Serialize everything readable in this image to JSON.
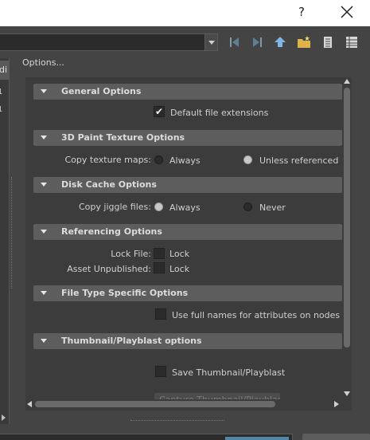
{
  "titlebar": {
    "help_label": "?",
    "close_icon": "close-icon"
  },
  "toolbar": {
    "path_value": "",
    "buttons": [
      "back-icon",
      "forward-icon",
      "parent-folder-icon",
      "new-folder-icon",
      "list-view-icon",
      "detail-view-icon"
    ]
  },
  "sidebar": {
    "tab_label": "di",
    "rows": [
      "1",
      "1"
    ]
  },
  "options": {
    "title": "Options...",
    "general": {
      "header": "General Options",
      "default_ext_label": "Default file extensions",
      "default_ext_checked": true
    },
    "paint": {
      "header": "3D Paint Texture Options",
      "copy_label": "Copy texture maps:",
      "always_label": "Always",
      "unless_label": "Unless referenced",
      "selected": "Unless referenced"
    },
    "cache": {
      "header": "Disk Cache Options",
      "copy_label": "Copy jiggle files:",
      "always_label": "Always",
      "never_label": "Never",
      "selected": "Always"
    },
    "referencing": {
      "header": "Referencing Options",
      "lock_file_label": "Lock File:",
      "lock_file_checkbox_label": "Lock",
      "asset_label": "Asset Unpublished:",
      "asset_checkbox_label": "Lock"
    },
    "filetype": {
      "header": "File Type Specific Options",
      "full_names_label": "Use full names for attributes on nodes"
    },
    "thumbnail": {
      "header": "Thumbnail/Playblast options",
      "save_label": "Save Thumbnail/Playblast",
      "capture_label": "Capture Thumbnail/Playblast"
    }
  }
}
